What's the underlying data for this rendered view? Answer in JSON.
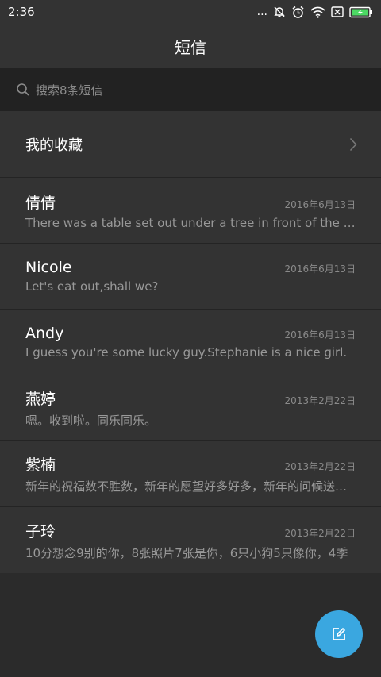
{
  "status": {
    "time": "2:36",
    "dots": "..."
  },
  "header": {
    "title": "短信"
  },
  "search": {
    "placeholder": "搜索8条短信"
  },
  "favorites": {
    "label": "我的收藏"
  },
  "conversations": [
    {
      "name": "倩倩",
      "date": "2016年6月13日",
      "preview": "There was a table set out under a tree in front of the house..."
    },
    {
      "name": "Nicole",
      "date": "2016年6月13日",
      "preview": "Let's eat out,shall we?"
    },
    {
      "name": "Andy",
      "date": "2016年6月13日",
      "preview": "I guess you're some lucky guy.Stephanie is a nice girl."
    },
    {
      "name": "燕婷",
      "date": "2013年2月22日",
      "preview": "嗯。收到啦。同乐同乐。"
    },
    {
      "name": "紫楠",
      "date": "2013年2月22日",
      "preview": "新年的祝福数不胜数，新年的愿望好多好多，新年的问候送给你"
    },
    {
      "name": "子玲",
      "date": "2013年2月22日",
      "preview": "10分想念9别的你，8张照片7张是你，6只小狗5只像你，4季"
    }
  ],
  "icons": {
    "status": [
      "mute-bell-icon",
      "alarm-clock-icon",
      "wifi-icon",
      "no-sim-icon",
      "battery-charging-icon"
    ],
    "search": "search-icon",
    "favorites": "chevron-right-icon",
    "fab": "compose-icon"
  },
  "colors": {
    "accent": "#3aa7e0",
    "battery": "#4cd964"
  }
}
